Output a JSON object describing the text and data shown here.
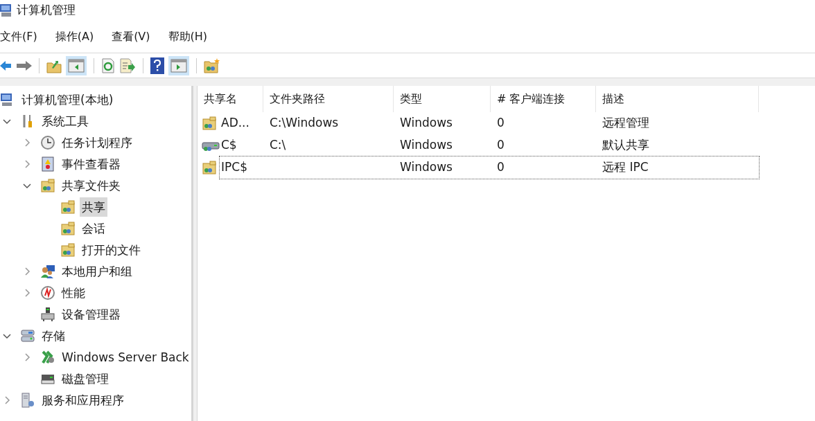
{
  "window": {
    "title": "计算机管理"
  },
  "menu_bar": [
    "文件(F)",
    "操作(A)",
    "查看(V)",
    "帮助(H)"
  ],
  "tree": [
    {
      "label": "计算机管理(本地)",
      "selected": false,
      "children": [
        {
          "label": "系统工具",
          "selected": false,
          "expanded": true,
          "children": [
            {
              "label": "任务计划程序",
              "selected": false,
              "expanded": false
            },
            {
              "label": "事件查看器",
              "selected": false,
              "expanded": false
            },
            {
              "label": "共享文件夹",
              "selected": false,
              "expanded": true,
              "children": [
                {
                  "label": "共享",
                  "selected": true
                },
                {
                  "label": "会话",
                  "selected": false
                },
                {
                  "label": "打开的文件",
                  "selected": false
                }
              ]
            },
            {
              "label": "本地用户和组",
              "selected": false,
              "expanded": false
            },
            {
              "label": "性能",
              "selected": false,
              "expanded": false
            },
            {
              "label": "设备管理器",
              "selected": false
            }
          ]
        },
        {
          "label": "存储",
          "selected": false,
          "expanded": true,
          "children": [
            {
              "label": "Windows Server Back",
              "selected": false,
              "expanded": false
            },
            {
              "label": "磁盘管理",
              "selected": false
            }
          ]
        },
        {
          "label": "服务和应用程序",
          "selected": false,
          "expanded": false
        }
      ]
    }
  ],
  "table": {
    "columns": [
      "共享名",
      "文件夹路径",
      "类型",
      "# 客户端连接",
      "描述"
    ],
    "rows": [
      {
        "cells": [
          "AD...",
          "C:\\Windows",
          "Windows",
          "0",
          "远程管理"
        ],
        "kind": "folder",
        "focused": false
      },
      {
        "cells": [
          "C$",
          "C:\\",
          "Windows",
          "0",
          "默认共享"
        ],
        "kind": "drive",
        "focused": false
      },
      {
        "cells": [
          "IPC$",
          "",
          "Windows",
          "0",
          "远程 IPC"
        ],
        "kind": "folder",
        "focused": true
      }
    ]
  }
}
